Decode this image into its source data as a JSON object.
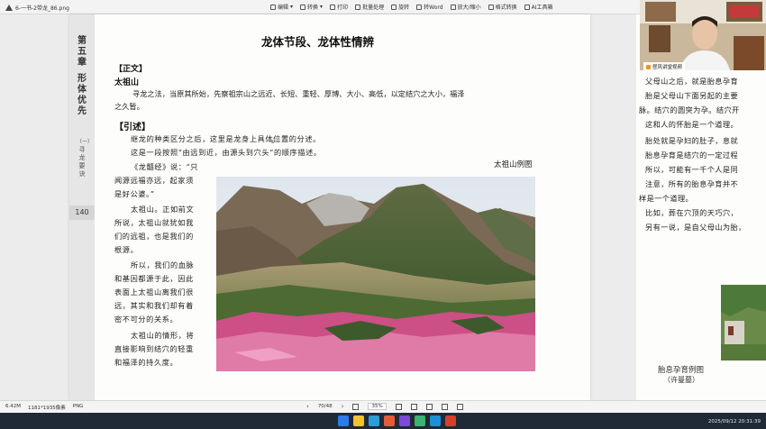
{
  "app": {
    "filename": "6-一书-2带龙_86.png",
    "toolbar": [
      "编辑",
      "转换",
      "打印",
      "批量处理",
      "旋转",
      "转Word",
      "放大/缩小",
      "格式转换",
      "AI工具箱"
    ]
  },
  "sidebar": {
    "chapter": "第五章",
    "section": "形体优先",
    "subsection_paren": "（一）",
    "subsection": "寻龙要诀",
    "page_number": "140"
  },
  "page": {
    "title": "龙体节段、龙体性情辨",
    "main_text_heading": "【正文】",
    "main_text_subtitle": "太祖山",
    "main_text_lines": [
      "寻龙之法，当原其所始，先察祖宗山之远近、长短、重轻、厚博、大小、高低，以定结穴之大小，福泽",
      "之久暂。"
    ],
    "commentary_heading": "【引述】",
    "marker": "⊕",
    "commentary_intro": [
      "继龙的种类区分之后，这里是龙身上具体位置的分述。",
      "这是一段按照“由远到近，由源头到穴头”的顺序描述。"
    ],
    "commentary_side": [
      "《龙髓经》说：“只",
      "闻源远福亦远，起家须",
      "是好公婆。”",
      "太祖山。正如前文",
      "所说，太祖山就犹如我",
      "们的远祖，也是我们的",
      "根源。",
      "所以，我们的血脉",
      "和基因都源于此，因此",
      "表面上太祖山离我们很",
      "远，其实和我们却有着",
      "密不可分的关系。",
      "太祖山的情形，将",
      "直接影响到结穴的轻重",
      "和福泽的持久度。"
    ],
    "photo_caption": "太祖山例图"
  },
  "right_page": {
    "lines": [
      "父母山之后，就是胎息孕育",
      "胎是父母山下面另起的主要",
      "脉。结穴的圆突为孕。结穴开",
      "这和人的怀胎是一个道理。",
      "胎处就是孕妇的肚子，息就",
      "胎息孕育是结穴的一定过程",
      "所以，可能有一千个人是同",
      "注意，所有的胎息孕育并不",
      "样是一个道理。",
      "比如，葬在穴顶的天巧穴，",
      "另有一说，是自父母山为胎，"
    ],
    "caption": "胎息孕育例图",
    "caption_sub": "（许曼墓）"
  },
  "webcam": {
    "name": "昼风讲堂视频"
  },
  "status": {
    "size": "6.42M",
    "dims": "1181*1935像素",
    "format": "PNG",
    "page_indicator": "70/48",
    "zoom": "35%"
  },
  "taskbar": {
    "clock": "2025/09/12 20:31:39"
  }
}
